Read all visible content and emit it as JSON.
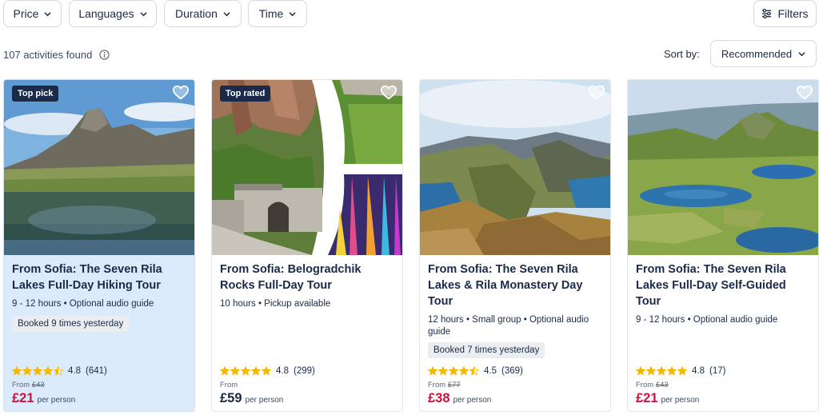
{
  "filters": {
    "price_label": "Price",
    "languages_label": "Languages",
    "duration_label": "Duration",
    "time_label": "Time",
    "filters_label": "Filters"
  },
  "results": {
    "count_text": "107 activities found"
  },
  "sort": {
    "label": "Sort by:",
    "value": "Recommended"
  },
  "colors": {
    "navy": "#1a2b49",
    "sale_red": "#d0103a",
    "star_yellow": "#f5b800",
    "highlight_bg": "#dcebfb"
  },
  "cards": [
    {
      "badge": "Top pick",
      "title": "From Sofia: The Seven Rila Lakes Full-Day Hiking Tour",
      "meta": "9 - 12 hours • Optional audio guide",
      "booked": "Booked 9 times yesterday",
      "rating": "4.8",
      "reviews": "(641)",
      "stars": 4.5,
      "from_label": "From",
      "old_price": "£43",
      "price": "£21",
      "per_person": "per person"
    },
    {
      "badge": "Top rated",
      "title": "From Sofia: Belogradchik Rocks Full-Day Tour",
      "meta": "10 hours • Pickup available",
      "rating": "4.8",
      "reviews": "(299)",
      "stars": 5,
      "from_label": "From",
      "price": "£59",
      "per_person": "per person"
    },
    {
      "title": "From Sofia: The Seven Rila Lakes & Rila Monastery Day Tour",
      "meta": "12 hours • Small group • Optional audio guide",
      "booked": "Booked 7 times yesterday",
      "rating": "4.5",
      "reviews": "(369)",
      "stars": 4.5,
      "from_label": "From",
      "old_price": "£77",
      "price": "£38",
      "per_person": "per person"
    },
    {
      "title": "From Sofia: The Seven Rila Lakes Full-Day Self-Guided Tour",
      "meta": "9 - 12 hours • Optional audio guide",
      "rating": "4.8",
      "reviews": "(17)",
      "stars": 5,
      "from_label": "From",
      "old_price": "£43",
      "price": "£21",
      "per_person": "per person"
    }
  ]
}
